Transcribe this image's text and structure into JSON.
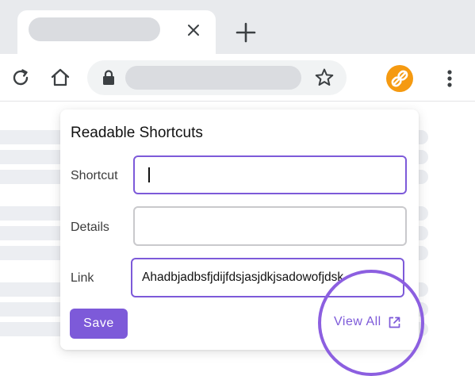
{
  "browser": {
    "icons": {
      "tab_close": "close-icon",
      "new_tab": "plus-icon",
      "reload": "reload-icon",
      "home": "home-icon",
      "lock": "lock-icon",
      "bookmark": "star-icon",
      "extension": "link-icon",
      "menu": "more-vert-icon"
    },
    "extension_color": "#f59a11"
  },
  "popup": {
    "title": "Readable Shortcuts",
    "fields": {
      "shortcut": {
        "label": "Shortcut",
        "value": ""
      },
      "details": {
        "label": "Details",
        "value": ""
      },
      "link": {
        "label": "Link",
        "value": "Ahadbjadbsfjdijfdsjasjdkjsadowofjdsk"
      }
    },
    "save_label": "Save",
    "view_all_label": "View All",
    "view_all_icon": "open-in-new-icon",
    "accent_color": "#7d5ad9"
  }
}
